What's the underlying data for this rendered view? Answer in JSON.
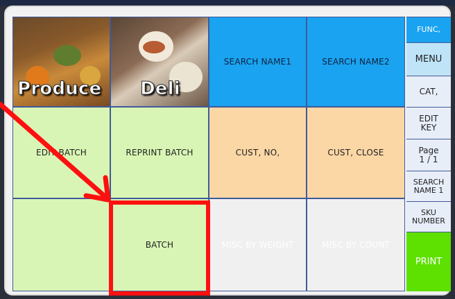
{
  "grid": {
    "produce_label": "Produce",
    "deli_label": "Deli",
    "search_name1": "SEARCH NAME1",
    "search_name2": "SEARCH NAME2",
    "edit_batch": "EDIT BATCH",
    "reprint_batch": "REPRINT BATCH",
    "cust_no": "CUST, NO,",
    "cust_close": "CUST, CLOSE",
    "batch": "BATCH",
    "misc_by_weight": "MISC BY WEIGHT",
    "misc_by_count": "MISC BY COUNT"
  },
  "sidebar": {
    "func": "FUNC,",
    "menu": "MENU",
    "cat": "CAT,",
    "edit_key": "EDIT KEY",
    "page": "Page 1 / 1",
    "search_name": "SEARCH NAME 1",
    "sku_number": "SKU NUMBER",
    "print": "PRINT"
  },
  "colors": {
    "green": "#d9f5b5",
    "blue": "#1aa3f0",
    "peach": "#fcd7a6",
    "print_green": "#5ee000",
    "annotation_red": "#ff1010"
  }
}
